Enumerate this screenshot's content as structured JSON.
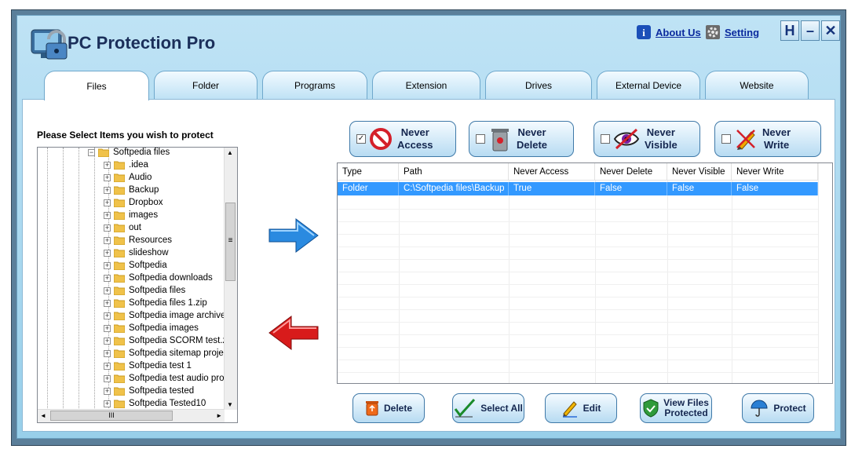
{
  "app": {
    "title": "PC Protection Pro",
    "about_label": "About Us",
    "setting_label": "Setting",
    "btn_help": "H",
    "btn_min": "–",
    "btn_close": "✕"
  },
  "tabs": [
    {
      "label": "Files",
      "active": true
    },
    {
      "label": "Folder"
    },
    {
      "label": "Programs"
    },
    {
      "label": "Extension"
    },
    {
      "label": "Drives"
    },
    {
      "label": "External Device"
    },
    {
      "label": "Website"
    }
  ],
  "tree": {
    "heading": "Please Select Items you wish to protect",
    "root": "Softpedia files",
    "items": [
      ".idea",
      "Audio",
      "Backup",
      "Dropbox",
      "images",
      "out",
      "Resources",
      "slideshow",
      "Softpedia",
      "Softpedia downloads",
      "Softpedia files",
      "Softpedia files 1.zip",
      "Softpedia image archive",
      "Softpedia images",
      "Softpedia SCORM test.z",
      "Softpedia sitemap projec",
      "Softpedia test 1",
      "Softpedia test audio proj",
      "Softpedia tested",
      "Softpedia Tested10"
    ],
    "hscroll_grip": "III",
    "vscroll_grip": "≡",
    "scroll_up": "▲",
    "scroll_down": "▼",
    "scroll_left": "◄",
    "scroll_right": "►"
  },
  "options": [
    {
      "line1": "Never",
      "line2": "Access",
      "checked": true,
      "icon": "no-entry-icon"
    },
    {
      "line1": "Never",
      "line2": "Delete",
      "checked": false,
      "icon": "trash-can-icon"
    },
    {
      "line1": "Never",
      "line2": "Visible",
      "checked": false,
      "icon": "eye-icon"
    },
    {
      "line1": "Never",
      "line2": "Write",
      "checked": false,
      "icon": "pencil-icon"
    }
  ],
  "grid": {
    "columns": [
      "Type",
      "Path",
      "Never Access",
      "Never Delete",
      "Never Visible",
      "Never Write"
    ],
    "rows": [
      [
        "Folder",
        "C:\\Softpedia files\\Backup",
        "True",
        "False",
        "False",
        "False"
      ]
    ]
  },
  "actions": {
    "delete": "Delete",
    "select_all": "Select All",
    "edit": "Edit",
    "view_line1": "View Files",
    "view_line2": "Protected",
    "protect": "Protect"
  },
  "colors": {
    "selection": "#3399ff",
    "title_text": "#1b2f5a",
    "arrow_right": "#2a8ae0",
    "arrow_left": "#d81b1b"
  }
}
